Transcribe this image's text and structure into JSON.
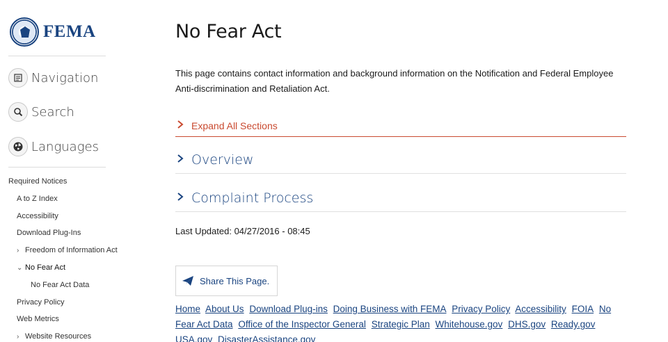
{
  "logo": {
    "text": "FEMA"
  },
  "sidebar": {
    "menu": [
      {
        "label": "Navigation",
        "icon": "menu-icon"
      },
      {
        "label": "Search",
        "icon": "search-icon"
      },
      {
        "label": "Languages",
        "icon": "globe-icon"
      }
    ],
    "notices_header": "Required Notices",
    "notices": [
      {
        "label": "A to Z Index"
      },
      {
        "label": "Accessibility"
      },
      {
        "label": "Download Plug-Ins"
      },
      {
        "label": "Freedom of Information Act",
        "expander": "collapsed"
      },
      {
        "label": "No Fear Act",
        "expander": "expanded"
      },
      {
        "label": "No Fear Act Data"
      },
      {
        "label": "Privacy Policy"
      },
      {
        "label": "Web Metrics"
      },
      {
        "label": "Website Resources",
        "expander": "collapsed"
      }
    ]
  },
  "main": {
    "title": "No Fear Act",
    "intro": "This page contains contact information and background information on the Notification and Federal Employee Anti-discrimination and Retaliation Act.",
    "expand_all": "Expand All Sections",
    "sections": [
      "Overview",
      "Complaint Process"
    ],
    "last_updated_label": "Last Updated:",
    "last_updated_value": "04/27/2016 - 08:45",
    "share_label": "Share This Page."
  },
  "footer": {
    "links": [
      "Home",
      "About Us",
      "Download Plug-ins",
      "Doing Business with FEMA",
      "Privacy Policy",
      "Accessibility",
      "FOIA",
      "No Fear Act Data",
      "Office of the Inspector General",
      "Strategic Plan",
      "Whitehouse.gov",
      "DHS.gov",
      "Ready.gov",
      "USA.gov",
      "DisasterAssistance.gov"
    ]
  },
  "colors": {
    "brand": "#1a4480",
    "accent": "#c94a30"
  }
}
